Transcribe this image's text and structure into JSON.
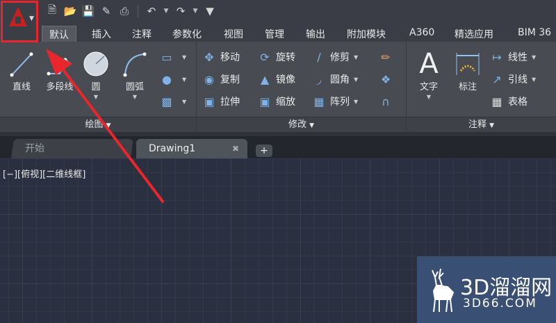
{
  "quick_access": {
    "icons": [
      "new-file-icon",
      "open-folder-icon",
      "save-icon",
      "save-as-icon",
      "print-icon",
      "undo-icon",
      "redo-icon",
      "customize-icon"
    ]
  },
  "tabs": [
    "默认",
    "插入",
    "注释",
    "参数化",
    "视图",
    "管理",
    "输出",
    "附加模块",
    "A360",
    "精选应用",
    "BIM 36"
  ],
  "active_tab": "默认",
  "panels": {
    "draw": {
      "label": "绘图",
      "line": "直线",
      "polyline": "多段线",
      "circle": "圆",
      "arc": "圆弧"
    },
    "modify": {
      "label": "修改",
      "move": "移动",
      "rotate": "旋转",
      "trim": "修剪",
      "copy": "复制",
      "mirror": "镜像",
      "fillet": "圆角",
      "stretch": "拉伸",
      "scale": "缩放",
      "array": "阵列"
    },
    "annotation": {
      "label": "注释",
      "text": "文字",
      "dimension": "标注",
      "linear": "线性",
      "leader": "引线",
      "table": "表格"
    }
  },
  "doc_tabs": {
    "start": "开始",
    "drawing": "Drawing1",
    "add": "+"
  },
  "viewport_label": "[−][俯视][二维线框]",
  "watermark": {
    "line1": "3D溜溜网",
    "line2": "3D66.COM"
  },
  "colors": {
    "accent_red": "#e8262b",
    "ribbon_bg": "#484c52",
    "canvas_bg": "#2b3040"
  }
}
